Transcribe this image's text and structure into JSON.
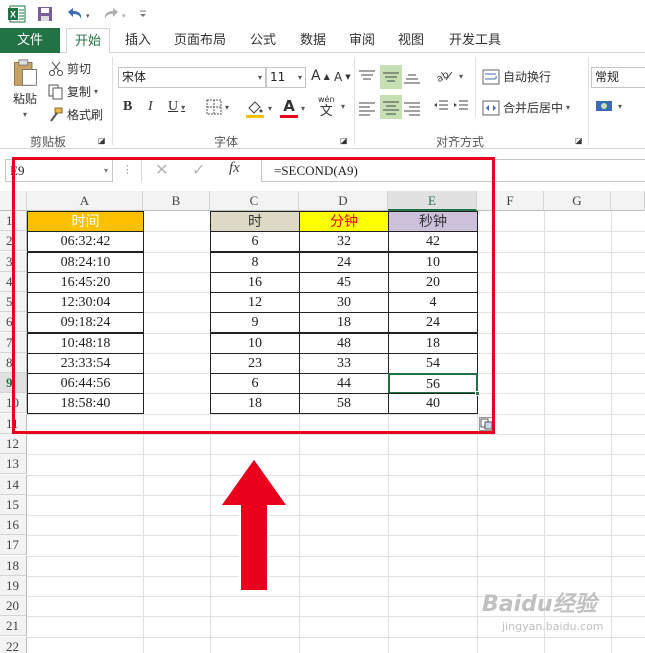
{
  "qat": {
    "excel_icon": "excel-logo-icon",
    "save_icon": "save-icon",
    "undo_icon": "undo-icon",
    "redo_icon": "redo-icon"
  },
  "tabs": [
    {
      "label": "文件"
    },
    {
      "label": "开始"
    },
    {
      "label": "插入"
    },
    {
      "label": "页面布局"
    },
    {
      "label": "公式"
    },
    {
      "label": "数据"
    },
    {
      "label": "审阅"
    },
    {
      "label": "视图"
    },
    {
      "label": "开发工具"
    }
  ],
  "ribbon": {
    "clipboard": {
      "paste": "粘贴",
      "cut": "剪切",
      "copy": "复制",
      "format_painter": "格式刷",
      "group": "剪贴板"
    },
    "font": {
      "font_name": "宋体",
      "font_size": "11",
      "grow": "A",
      "shrink": "A",
      "bold": "B",
      "italic": "I",
      "underline": "U",
      "font_color": "A",
      "phonetic": "wén",
      "phonetic_char": "文",
      "group": "字体"
    },
    "alignment": {
      "wrap_text": "自动换行",
      "merge_center": "合并后居中",
      "group": "对齐方式"
    },
    "number": {
      "format": "常规"
    }
  },
  "formula_bar": {
    "name_box": "E9",
    "fx": "fx",
    "formula": "=SECOND(A9)"
  },
  "columns": [
    "A",
    "B",
    "C",
    "D",
    "E",
    "F",
    "G"
  ],
  "rows": [
    "1",
    "2",
    "3",
    "4",
    "5",
    "6",
    "7",
    "8",
    "9",
    "10",
    "11",
    "12",
    "13",
    "14",
    "15",
    "16",
    "17",
    "18",
    "19",
    "20",
    "21",
    "22"
  ],
  "table_left": {
    "header": "时间",
    "values": [
      "06:32:42",
      "08:24:10",
      "16:45:20",
      "12:30:04",
      "09:18:24",
      "10:48:18",
      "23:33:54",
      "06:44:56",
      "18:58:40"
    ]
  },
  "table_right": {
    "headers": [
      "时",
      "分钟",
      "秒钟"
    ],
    "rows": [
      [
        "6",
        "32",
        "42"
      ],
      [
        "8",
        "24",
        "10"
      ],
      [
        "16",
        "45",
        "20"
      ],
      [
        "12",
        "30",
        "4"
      ],
      [
        "9",
        "18",
        "24"
      ],
      [
        "10",
        "48",
        "18"
      ],
      [
        "23",
        "33",
        "54"
      ],
      [
        "6",
        "44",
        "56"
      ],
      [
        "18",
        "58",
        "40"
      ]
    ]
  },
  "colors": {
    "excel_green": "#217346",
    "header_time": "#ffc000",
    "header_hour": "#ddd9c4",
    "header_minute": "#ffff00",
    "header_second": "#ccc0da",
    "annotation_red": "#e8001c"
  },
  "watermark": {
    "brand": "Baidu经验",
    "site": "jingyan.baidu.com"
  }
}
